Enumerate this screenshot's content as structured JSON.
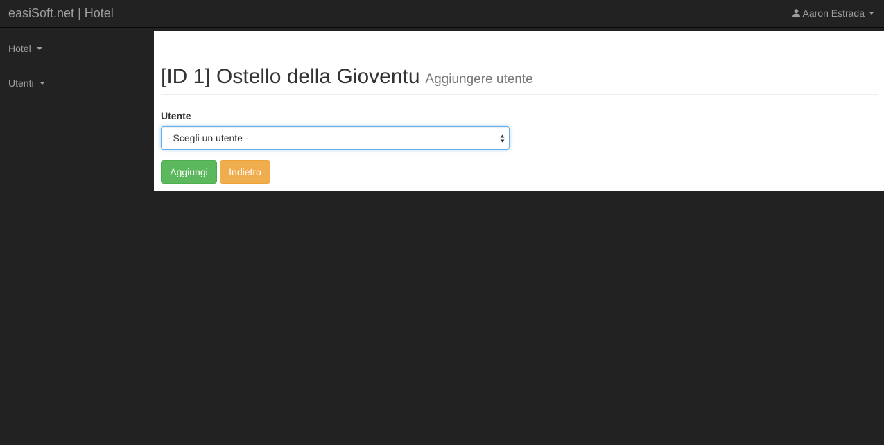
{
  "navbar": {
    "brand": "easiSoft.net | Hotel",
    "user_name": "Aaron Estrada"
  },
  "sidebar": {
    "items": [
      {
        "label": "Hotel"
      },
      {
        "label": "Utenti"
      }
    ]
  },
  "main": {
    "title": "[ID 1] Ostello della Gioventu",
    "subtitle": "Aggiungere utente",
    "form": {
      "label": "Utente",
      "select_value": "- Scegli un utente -"
    },
    "buttons": {
      "add_label": "Aggiungi",
      "back_label": "Indietro"
    }
  },
  "colors": {
    "navbar_bg": "#222222",
    "success": "#5cb85c",
    "warning": "#f0ad4e",
    "focus_border": "#66afe9"
  }
}
